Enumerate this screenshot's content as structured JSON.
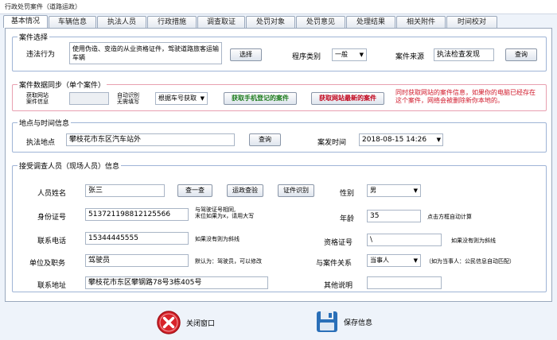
{
  "window": {
    "title": "行政处罚案件（道路运政）"
  },
  "tabs": [
    "基本情况",
    "车辆信息",
    "执法人员",
    "行政措施",
    "调查取证",
    "处罚对象",
    "处罚意见",
    "处理结果",
    "相关附件",
    "时间校对"
  ],
  "case_select": {
    "legend": "案件选择",
    "violation_label": "违法行为",
    "violation_value": "使用伪造、变造的从业资格证件，驾驶道路旅客运输车辆",
    "select_button": "选择",
    "procedure_label": "程序类别",
    "procedure_value": "一般",
    "source_label": "案件来源",
    "source_value": "执法检查发现",
    "query_button": "查询"
  },
  "sync": {
    "legend": "案件数据同步（单个案件）",
    "fetch_label_1": "获取网站",
    "fetch_label_2": "案件信息",
    "auto_label_1": "自动识别",
    "auto_label_2": "无需填写",
    "plate_select": "根据车号获取",
    "mobile_button": "获取手机登记的案件",
    "latest_button": "获取网站最新的案件",
    "notice": "同时获取网站的案件信息，如果你的电脑已经存在这个案件，网络会被删除新你本地的。"
  },
  "place_time": {
    "legend": "地点与时间信息",
    "place_label": "执法地点",
    "place_value": "攀枝花市东区汽车站外",
    "query_button": "查询",
    "time_label": "案发时间",
    "time_value": "2018-08-15 14:26"
  },
  "person": {
    "legend": "接受调查人员（现场人员）信息",
    "name_label": "人员姓名",
    "name_value": "张三",
    "check_button": "查一查",
    "road_check_button": "运政查验",
    "id_recognize_button": "证件识别",
    "gender_label": "性别",
    "gender_value": "男",
    "id_label": "身份证号",
    "id_value": "513721198812125566",
    "id_note_1": "与驾驶证号相同,",
    "id_note_2": "末位如果为x，请用大写",
    "age_label": "年龄",
    "age_value": "35",
    "age_note": "点击方框自动计算",
    "phone_label": "联系电话",
    "phone_value": "15344445555",
    "phone_note": "如果没有则为斜线",
    "qual_label": "资格证号",
    "qual_value": "\\",
    "qual_note": "如果没有则为斜线",
    "unit_label": "单位及职务",
    "unit_value": "驾驶员",
    "unit_note": "默认为：驾驶员，可以修改",
    "relation_label": "与案件关系",
    "relation_value": "当事人",
    "relation_note": "（如为当事人：公民信息自动匹配）",
    "address_label": "联系地址",
    "address_value": "攀枝花市东区攀钢路78号3栋405号",
    "other_label": "其他说明",
    "other_value": ""
  },
  "footer": {
    "close_label": "关闭窗口",
    "save_label": "保存信息"
  },
  "colors": {
    "close_red": "#d8232a",
    "save_blue": "#2a6fb8",
    "notice_red": "#d0182a"
  }
}
